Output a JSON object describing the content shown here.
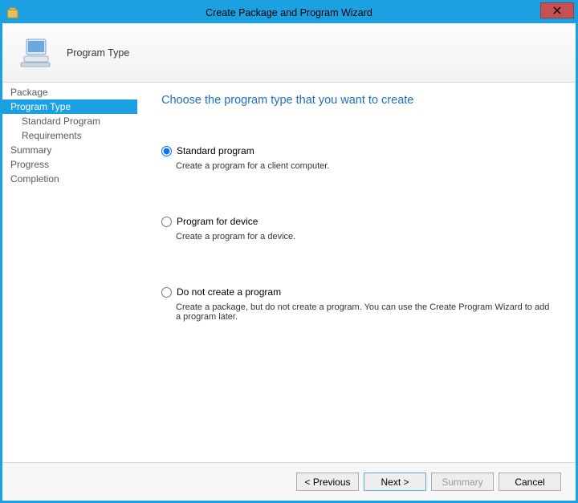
{
  "window": {
    "title": "Create Package and Program Wizard"
  },
  "header": {
    "title": "Program Type"
  },
  "sidebar": {
    "items": [
      {
        "label": "Package",
        "indent": false,
        "active": false
      },
      {
        "label": "Program Type",
        "indent": false,
        "active": true
      },
      {
        "label": "Standard Program",
        "indent": true,
        "active": false
      },
      {
        "label": "Requirements",
        "indent": true,
        "active": false
      },
      {
        "label": "Summary",
        "indent": false,
        "active": false
      },
      {
        "label": "Progress",
        "indent": false,
        "active": false
      },
      {
        "label": "Completion",
        "indent": false,
        "active": false
      }
    ]
  },
  "content": {
    "heading": "Choose the program type that you want to create",
    "options": [
      {
        "id": "standard",
        "label": "Standard program",
        "description": "Create a program for a client computer.",
        "selected": true
      },
      {
        "id": "device",
        "label": "Program for device",
        "description": "Create a program for a device.",
        "selected": false
      },
      {
        "id": "none",
        "label": "Do not create a program",
        "description": "Create a package, but do not create a program. You can use the Create Program Wizard to add a program later.",
        "selected": false
      }
    ]
  },
  "footer": {
    "previous": "< Previous",
    "next": "Next >",
    "summary": "Summary",
    "cancel": "Cancel"
  }
}
